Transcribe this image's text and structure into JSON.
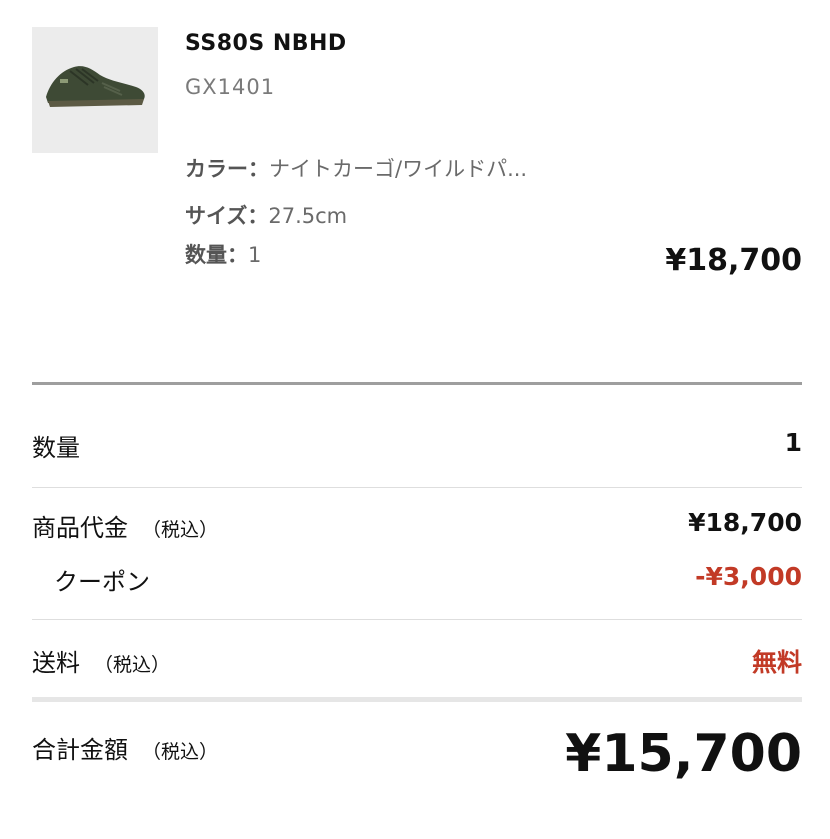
{
  "product": {
    "name": "SS80S NBHD",
    "code": "GX1401",
    "color_label": "カラー：",
    "color_value": "ナイトカーゴ/ワイルドパ...",
    "size_label": "サイズ：",
    "size_value": "27.5cm",
    "qty_label": "数量：",
    "qty_value": "1",
    "price": "¥18,700",
    "thumb_bg": "#ececec",
    "shoe_color": "#3e4a35"
  },
  "summary": {
    "qty_label": "数量",
    "qty_value": "1",
    "subtotal_label": "商品代金",
    "subtotal_tax": "（税込）",
    "subtotal_value": "¥18,700",
    "coupon_label": "クーポン",
    "coupon_value": "-¥3,000",
    "shipping_label": "送料",
    "shipping_tax": "（税込）",
    "shipping_value": "無料",
    "total_label": "合計金額",
    "total_tax": "（税込）",
    "total_value": "¥15,700"
  },
  "colors": {
    "accent_red": "#c23a26",
    "divider": "#9e9e9e"
  }
}
